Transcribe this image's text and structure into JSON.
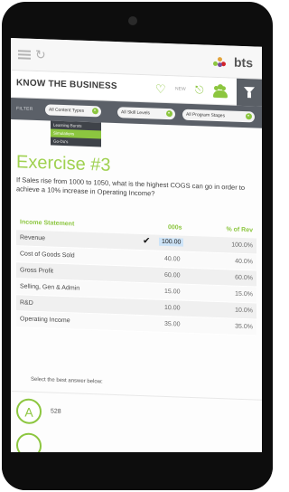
{
  "header": {
    "brand_name": "bts",
    "brand_dot_colors": [
      "#8cc63f",
      "#e3a43b",
      "#d2232a",
      "#7a4b9a"
    ]
  },
  "title_bar": {
    "title": "KNOW THE BUSINESS",
    "small_label": "NEW"
  },
  "filter_bar": {
    "label": "FILTER",
    "selects": [
      "All Content Types",
      "All Skill Levels",
      "All Program Stages"
    ]
  },
  "dropdown": {
    "items": [
      "Learning Bursts",
      "Simulations",
      "Go-Do's"
    ],
    "active_index": 1
  },
  "exercise": {
    "title": "Exercise #3",
    "question": "If Sales rise from 1000 to 1050, what is the highest COGS can go in order to achieve a 10% increase in Operating Income?"
  },
  "table": {
    "headers": [
      "Income Statement",
      "000s",
      "% of Rev"
    ],
    "rows": [
      {
        "label": "Revenue",
        "value": "100.00",
        "pct": "100.0%",
        "highlight": true
      },
      {
        "label": "Cost of Goods Sold",
        "value": "40.00",
        "pct": "40.0%"
      },
      {
        "label": "Gross Profit",
        "value": "60.00",
        "pct": "60.0%"
      },
      {
        "label": "Selling, Gen & Admin",
        "value": "15.00",
        "pct": "15.0%"
      },
      {
        "label": "R&D",
        "value": "10.00",
        "pct": "10.0%"
      },
      {
        "label": "Operating Income",
        "value": "35.00",
        "pct": "35.0%"
      }
    ]
  },
  "answers": {
    "prompt": "Select the best answer below:",
    "options": [
      {
        "letter": "A",
        "text": "528"
      }
    ]
  },
  "colors": {
    "accent": "#8cc63f",
    "filter_bar": "#5b6068",
    "bezel": "#0d0d0d"
  },
  "icons": {
    "menu": "hamburger-icon",
    "refresh": "refresh-icon",
    "favorite": "heart-icon",
    "tag": "tag-icon",
    "people": "people-icon",
    "filter": "funnel-icon",
    "check": "check-icon"
  }
}
